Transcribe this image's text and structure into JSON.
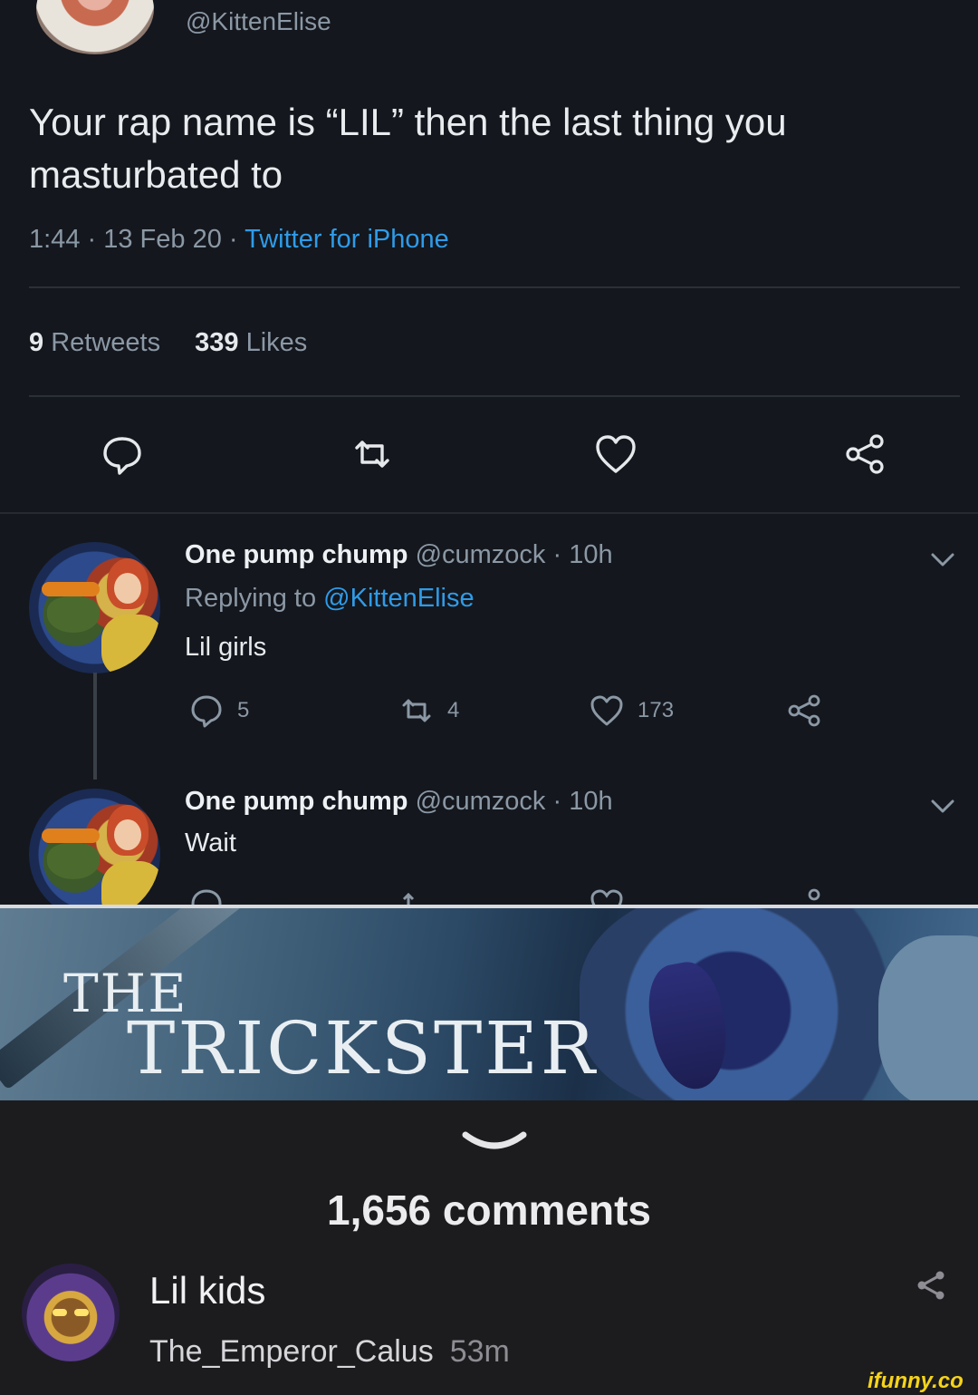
{
  "tweet": {
    "handle": "@KittenElise",
    "text": "Your rap name is “LIL” then the last thing you masturbated to",
    "time": "1:44",
    "date": "13 Feb 20",
    "source": "Twitter for iPhone",
    "retweets_count": "9",
    "retweets_label": "Retweets",
    "likes_count": "339",
    "likes_label": "Likes"
  },
  "replies": [
    {
      "name": "One pump chump",
      "handle": "@cumzock",
      "time": "10h",
      "replying_prefix": "Replying to",
      "replying_to": "@KittenElise",
      "text": "Lil girls",
      "reply_count": "5",
      "retweet_count": "4",
      "like_count": "173"
    },
    {
      "name": "One pump chump",
      "handle": "@cumzock",
      "time": "10h",
      "text": "Wait"
    }
  ],
  "meme": {
    "line1": "THE",
    "line2": "TRICKSTER"
  },
  "footer": {
    "comments_count": "1,656 comments",
    "comment_text": "Lil kids",
    "comment_user": "The_Emperor_Calus",
    "comment_time": "53m",
    "watermark": "ifunny.co"
  },
  "colors": {
    "link_blue": "#2f9be8",
    "muted": "#8b98a5",
    "background": "#14171d",
    "watermark_yellow": "#f6d31a"
  }
}
